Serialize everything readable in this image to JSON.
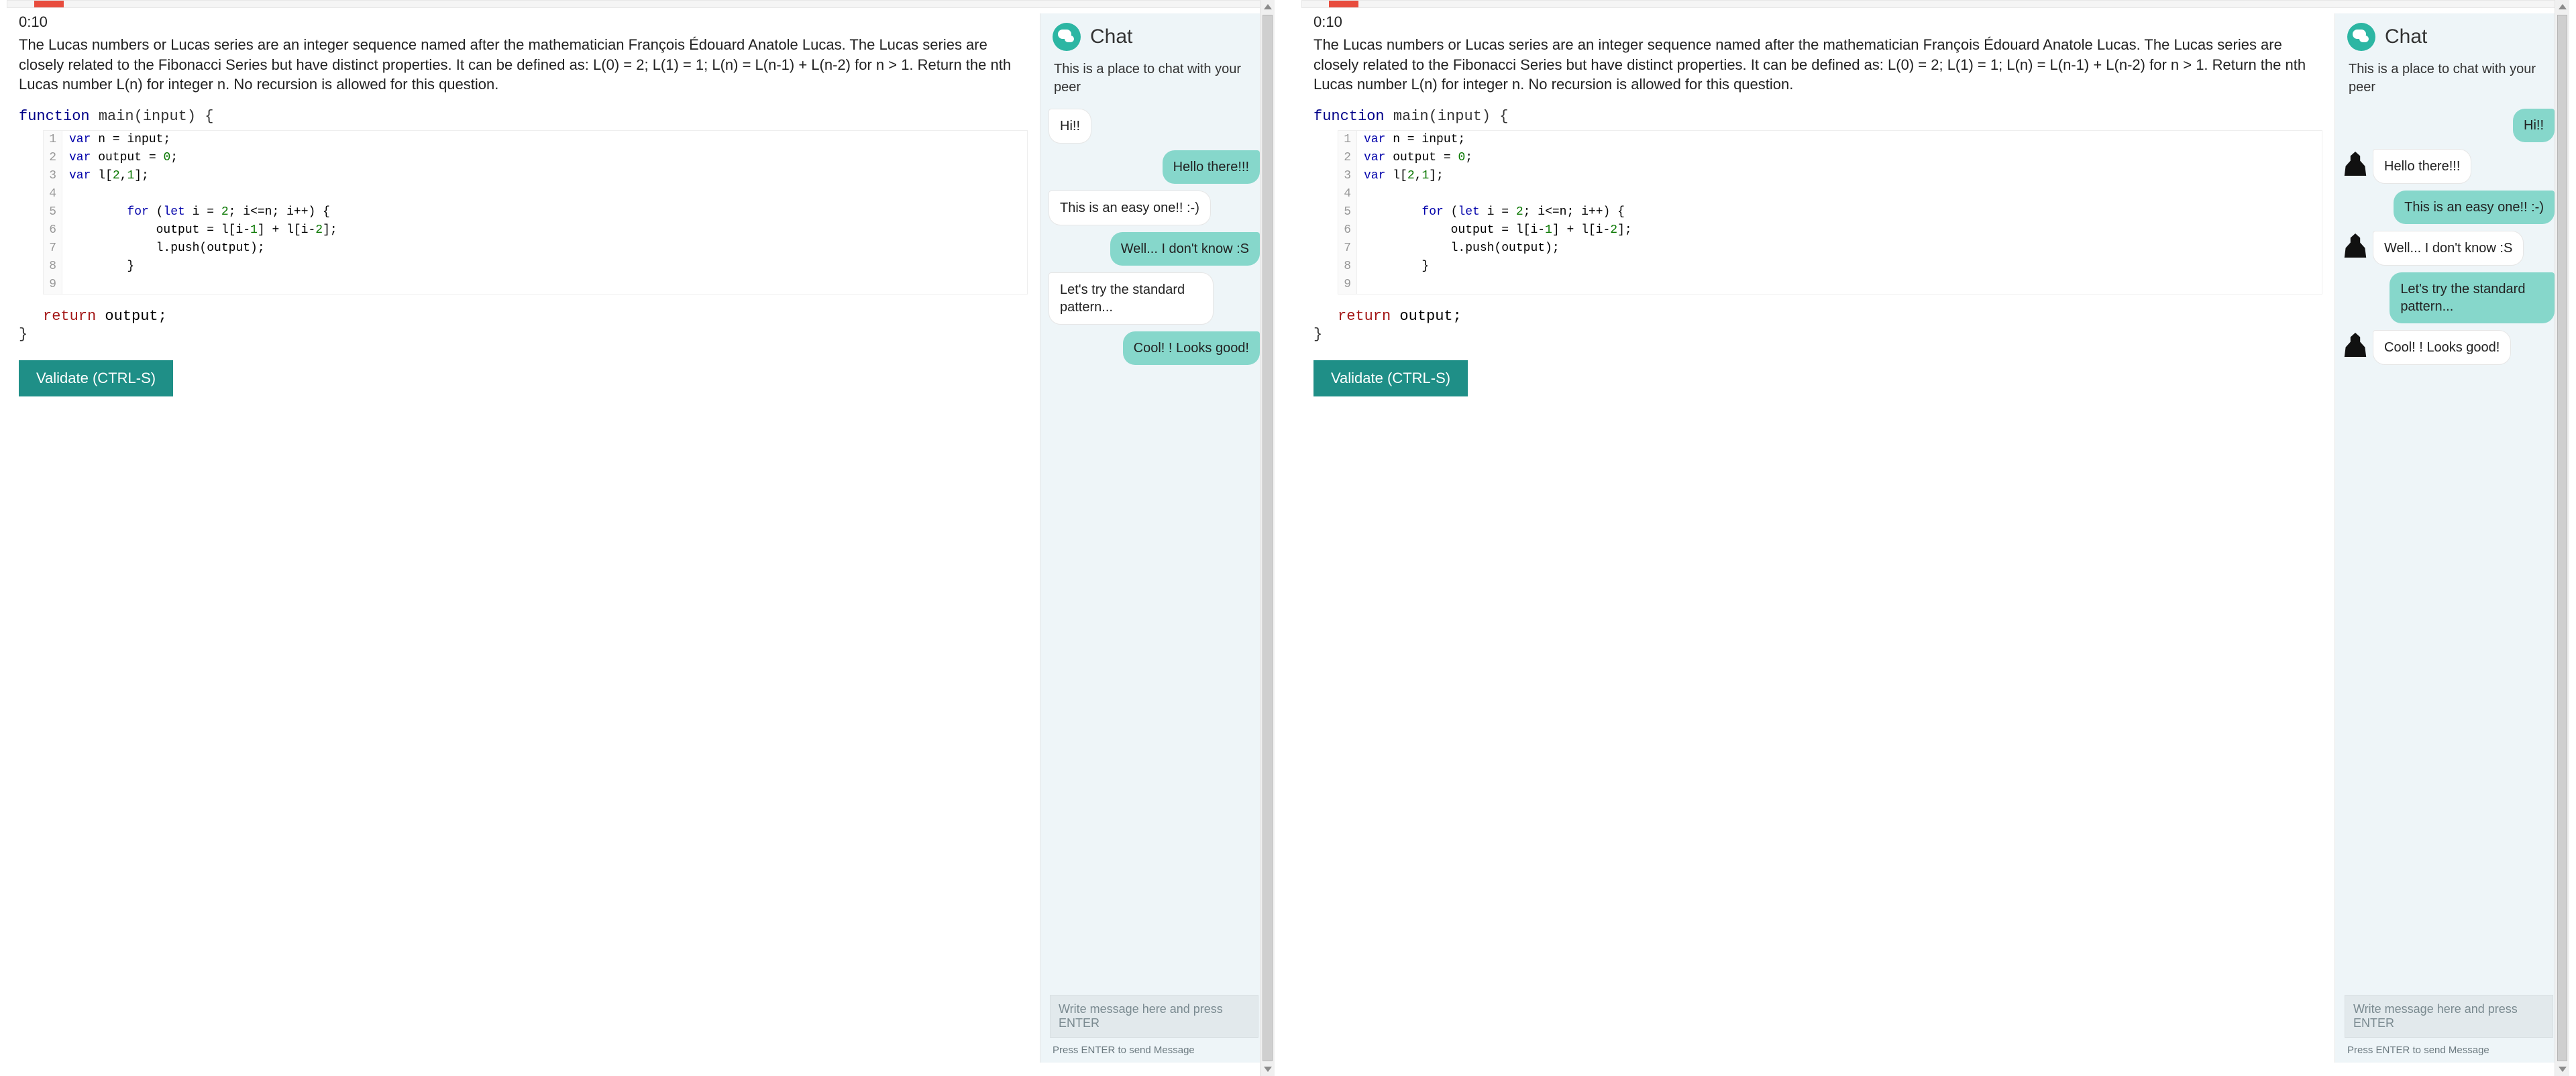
{
  "timer": "0:10",
  "prompt": "The Lucas numbers or Lucas series are an integer sequence named after the mathematician François Édouard Anatole Lucas. The Lucas series are closely related to the Fibonacci Series but have distinct properties. It can be defined as: L(0) = 2; L(1) = 1; L(n) = L(n-1) + L(n-2) for n > 1. Return the nth Lucas number L(n) for integer n. No recursion is allowed for this question.",
  "function_head": "function main(input) {",
  "function_close": "}",
  "return_line": "return output;",
  "validate_label": "Validate (CTRL-S)",
  "editor_lines": [
    "var n = input;",
    "var output = 0;",
    "var l[2,1];",
    "",
    "        for (let i = 2; i<=n; i++) {",
    "            output = l[i-1] + l[i-2];",
    "            l.push(output);",
    "        }",
    ""
  ],
  "chat": {
    "title": "Chat",
    "desc": "This is a place to chat with your peer",
    "input_placeholder": "Write message here and press ENTER",
    "enter_hint": "Press ENTER to send Message",
    "messages": [
      {
        "text": "Hi!!",
        "mine": false
      },
      {
        "text": "Hello there!!!",
        "mine": true
      },
      {
        "text": "This is an easy one!! :-)",
        "mine": false
      },
      {
        "text": "Well... I don't know :S",
        "mine": true
      },
      {
        "text": "Let's try the standard pattern...",
        "mine": false
      },
      {
        "text": "Cool! ! Looks good!",
        "mine": true
      }
    ]
  },
  "panels": [
    {
      "show_avatars": false,
      "flip_mine": false
    },
    {
      "show_avatars": true,
      "flip_mine": true
    }
  ],
  "colors": {
    "accent": "#1f8f87",
    "bubble_mine": "#86d7cb",
    "chat_bg": "#eef5f8",
    "progress_red": "#e84c3d"
  }
}
